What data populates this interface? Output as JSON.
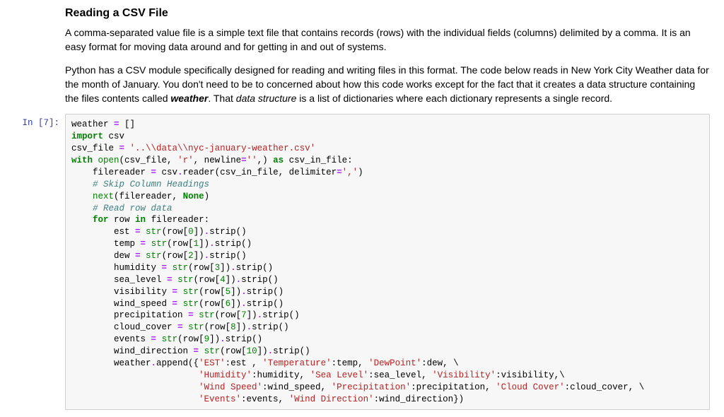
{
  "heading": "Reading a CSV File",
  "para1": "A comma-separated value file is a simple text file that contains records (rows) with the individual fields (columns) delimited by a comma. It is an easy format for moving data around and for getting in and out of systems.",
  "para2_a": "Python has a CSV module specifically designed for reading and writing files in this format. The code below reads in New York City Weather data for the month of January. You don't need to be to concerned about how this code works except for the fact that it creates a data structure containing the files contents called ",
  "para2_bold": "weather",
  "para2_b": ". That ",
  "para2_em": "data structure",
  "para2_c": " is a list of dictionaries where each dictionary represents a single record.",
  "prompt": "In [7]:",
  "code": {
    "l01a": "weather ",
    "l01b": "=",
    "l01c": " []",
    "l02a": "import",
    "l02b": " csv",
    "l03a": "csv_file ",
    "l03b": "=",
    "l03c": " ",
    "l03d": "'..\\\\data\\\\nyc-january-weather.csv'",
    "l04a": "with",
    "l04b": " ",
    "l04c": "open",
    "l04d": "(csv_file, ",
    "l04e": "'r'",
    "l04f": ", newline",
    "l04g": "=",
    "l04h": "''",
    "l04i": ",) ",
    "l04j": "as",
    "l04k": " csv_in_file:",
    "l05a": "    filereader ",
    "l05b": "=",
    "l05c": " csv",
    "l05d": ".",
    "l05e": "reader(csv_in_file, delimiter",
    "l05f": "=",
    "l05g": "','",
    "l05h": ")",
    "l06": "    # Skip Column Headings",
    "l07a": "    ",
    "l07b": "next",
    "l07c": "(filereader, ",
    "l07d": "None",
    "l07e": ")",
    "l08": "    # Read row data",
    "l09a": "    ",
    "l09b": "for",
    "l09c": " row ",
    "l09d": "in",
    "l09e": " filereader:",
    "l10a": "        est ",
    "l10b": "=",
    "l10c": " ",
    "l10d": "str",
    "l10e": "(row[",
    "l10f": "0",
    "l10g": "])",
    "l10h": ".",
    "l10i": "strip()",
    "l11a": "        temp ",
    "l11b": "=",
    "l11c": " ",
    "l11d": "str",
    "l11e": "(row[",
    "l11f": "1",
    "l11g": "])",
    "l11h": ".",
    "l11i": "strip()",
    "l12a": "        dew ",
    "l12b": "=",
    "l12c": " ",
    "l12d": "str",
    "l12e": "(row[",
    "l12f": "2",
    "l12g": "])",
    "l12h": ".",
    "l12i": "strip()",
    "l13a": "        humidity ",
    "l13b": "=",
    "l13c": " ",
    "l13d": "str",
    "l13e": "(row[",
    "l13f": "3",
    "l13g": "])",
    "l13h": ".",
    "l13i": "strip()",
    "l14a": "        sea_level ",
    "l14b": "=",
    "l14c": " ",
    "l14d": "str",
    "l14e": "(row[",
    "l14f": "4",
    "l14g": "])",
    "l14h": ".",
    "l14i": "strip()",
    "l15a": "        visibility ",
    "l15b": "=",
    "l15c": " ",
    "l15d": "str",
    "l15e": "(row[",
    "l15f": "5",
    "l15g": "])",
    "l15h": ".",
    "l15i": "strip()",
    "l16a": "        wind_speed ",
    "l16b": "=",
    "l16c": " ",
    "l16d": "str",
    "l16e": "(row[",
    "l16f": "6",
    "l16g": "])",
    "l16h": ".",
    "l16i": "strip()",
    "l17a": "        precipitation ",
    "l17b": "=",
    "l17c": " ",
    "l17d": "str",
    "l17e": "(row[",
    "l17f": "7",
    "l17g": "])",
    "l17h": ".",
    "l17i": "strip()",
    "l18a": "        cloud_cover ",
    "l18b": "=",
    "l18c": " ",
    "l18d": "str",
    "l18e": "(row[",
    "l18f": "8",
    "l18g": "])",
    "l18h": ".",
    "l18i": "strip()",
    "l19a": "        events ",
    "l19b": "=",
    "l19c": " ",
    "l19d": "str",
    "l19e": "(row[",
    "l19f": "9",
    "l19g": "])",
    "l19h": ".",
    "l19i": "strip()",
    "l20a": "        wind_direction ",
    "l20b": "=",
    "l20c": " ",
    "l20d": "str",
    "l20e": "(row[",
    "l20f": "10",
    "l20g": "])",
    "l20h": ".",
    "l20i": "strip()",
    "l21a": "        weather",
    "l21b": ".",
    "l21c": "append({",
    "l21d": "'EST'",
    "l21e": ":est , ",
    "l21f": "'Temperature'",
    "l21g": ":temp, ",
    "l21h": "'DewPoint'",
    "l21i": ":dew, \\",
    "l22a": "                        ",
    "l22b": "'Humidity'",
    "l22c": ":humidity, ",
    "l22d": "'Sea Level'",
    "l22e": ":sea_level, ",
    "l22f": "'Visibility'",
    "l22g": ":visibility,\\",
    "l23a": "                        ",
    "l23b": "'Wind Speed'",
    "l23c": ":wind_speed, ",
    "l23d": "'Precipitation'",
    "l23e": ":precipitation, ",
    "l23f": "'Cloud Cover'",
    "l23g": ":cloud_cover, \\",
    "l24a": "                        ",
    "l24b": "'Events'",
    "l24c": ":events, ",
    "l24d": "'Wind Direction'",
    "l24e": ":wind_direction})"
  }
}
